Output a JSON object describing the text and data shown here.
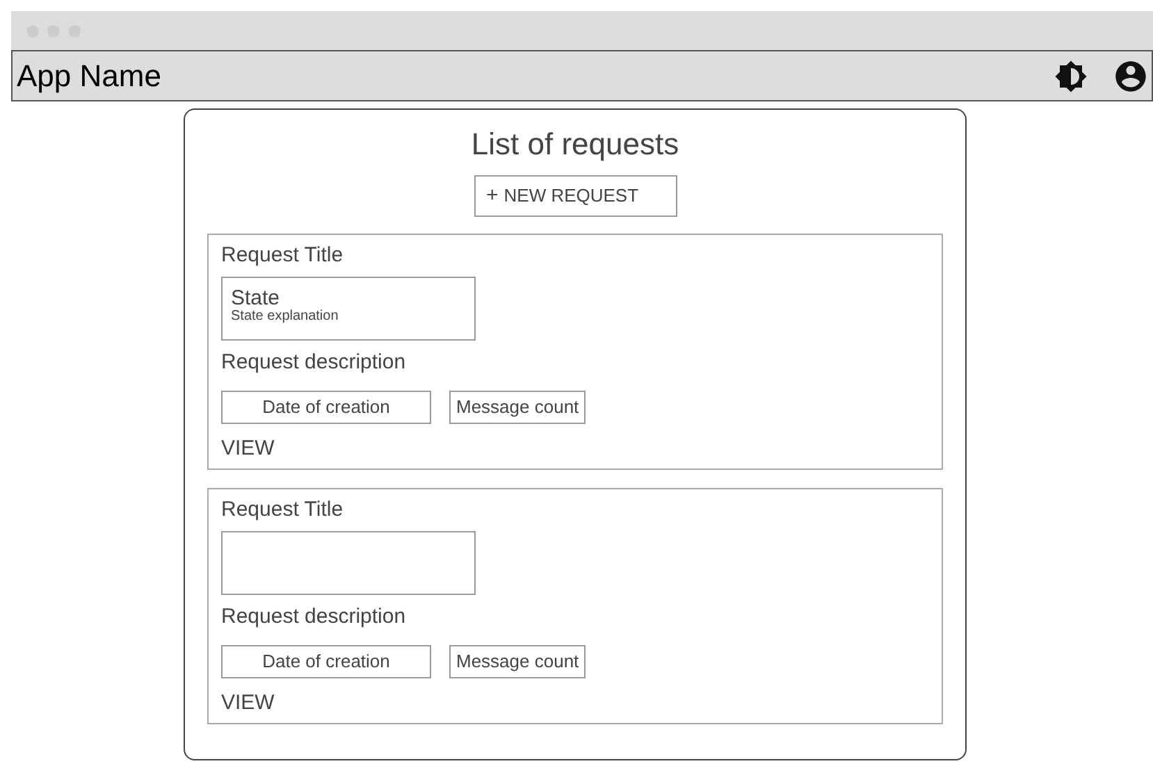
{
  "app_bar": {
    "title": "App Name"
  },
  "page": {
    "title": "List of requests",
    "new_button": "NEW REQUEST",
    "new_button_icon": "+"
  },
  "requests": [
    {
      "title": "Request Title",
      "state": {
        "name": "State",
        "explanation": "State explanation"
      },
      "description": "Request description",
      "date": "Date of creation",
      "messages": "Message count",
      "action": "VIEW"
    },
    {
      "title": "Request Title",
      "description": "Request description",
      "date": "Date of creation",
      "messages": "Message count",
      "action": "VIEW"
    }
  ]
}
